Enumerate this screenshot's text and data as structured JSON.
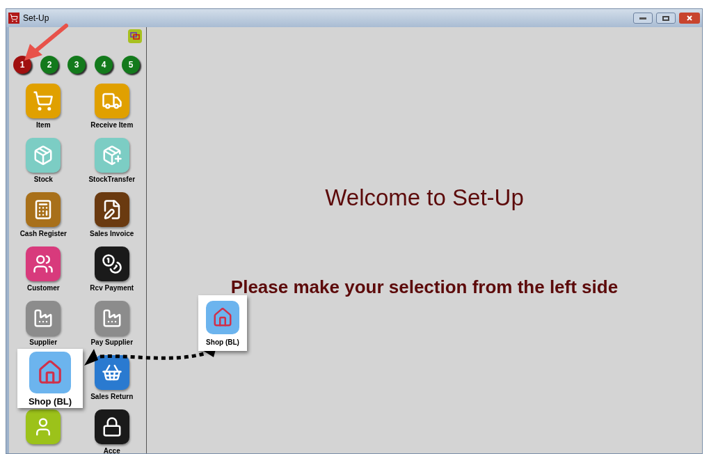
{
  "window": {
    "title": "Set-Up"
  },
  "pages": [
    {
      "label": "1",
      "selected": true
    },
    {
      "label": "2",
      "selected": false
    },
    {
      "label": "3",
      "selected": false
    },
    {
      "label": "4",
      "selected": false
    },
    {
      "label": "5",
      "selected": false
    }
  ],
  "modules": [
    {
      "kind": "tile",
      "label": "Item"
    },
    {
      "kind": "tile",
      "label": "Receive Item"
    },
    {
      "kind": "tile",
      "label": "Stock"
    },
    {
      "kind": "tile",
      "label": "StockTransfer"
    },
    {
      "kind": "tile",
      "label": "Cash Register"
    },
    {
      "kind": "tile",
      "label": "Sales Invoice"
    },
    {
      "kind": "tile",
      "label": "Customer"
    },
    {
      "kind": "tile",
      "label": "Rcv Payment"
    },
    {
      "kind": "tile",
      "label": "Supplier"
    },
    {
      "kind": "tile",
      "label": "Pay Supplier"
    },
    {
      "kind": "blank"
    },
    {
      "kind": "tile",
      "label": "Sales Return"
    },
    {
      "kind": "tile"
    },
    {
      "kind": "tile",
      "label": "Acce"
    }
  ],
  "welcome": {
    "title": "Welcome to Set-Up",
    "subtitle": "Please make your selection from the left side"
  },
  "callouts": [
    {
      "label": "Shop (BL)"
    },
    {
      "label": "Shop (BL)"
    }
  ]
}
